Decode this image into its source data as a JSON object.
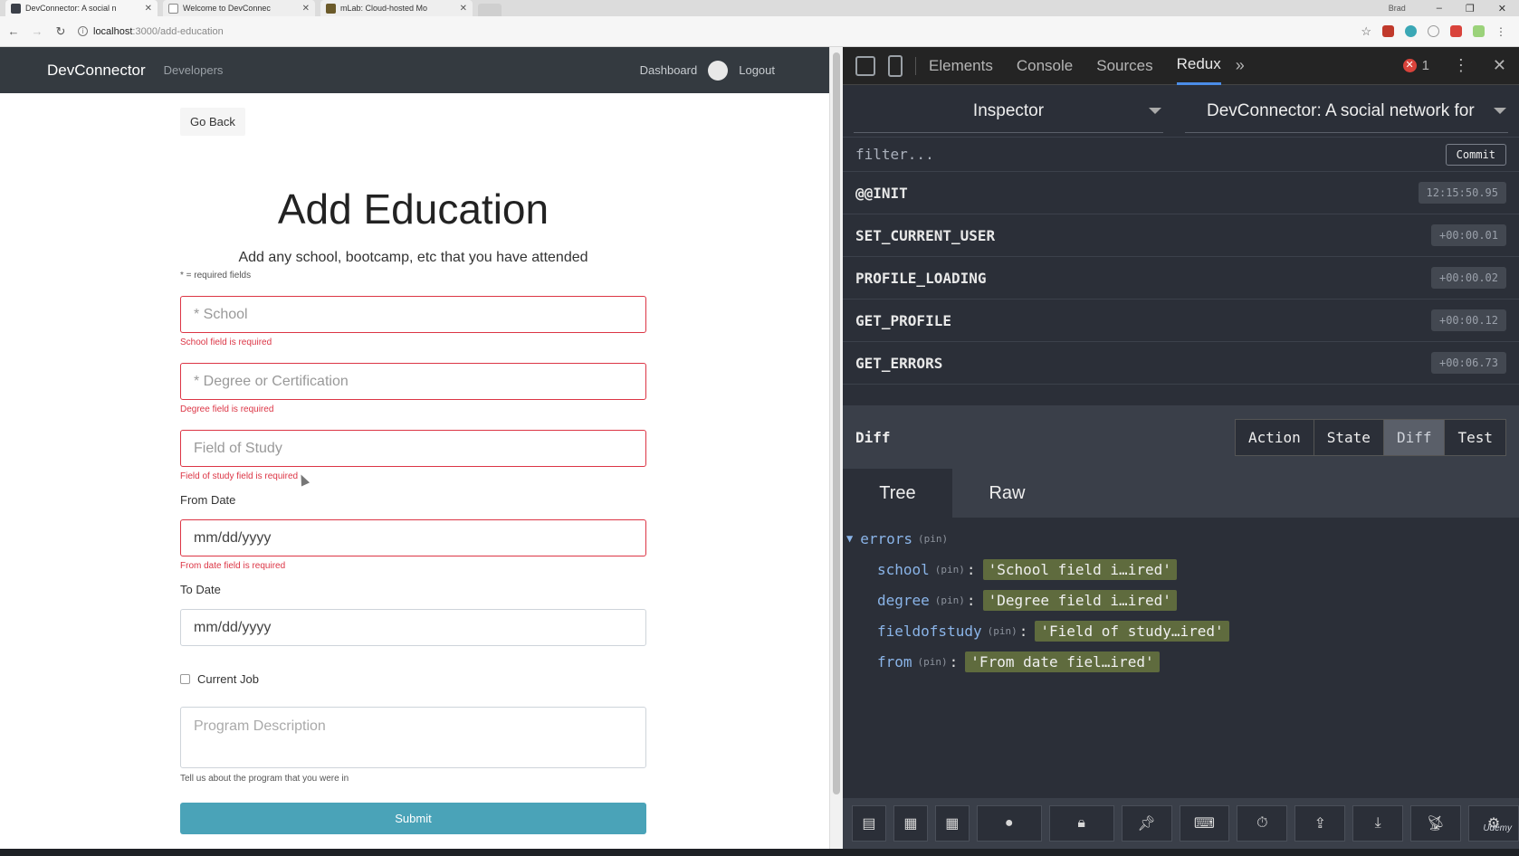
{
  "browser": {
    "tabs": [
      {
        "title": "DevConnector: A social n",
        "active": true
      },
      {
        "title": "Welcome to DevConnec",
        "active": false
      },
      {
        "title": "mLab: Cloud-hosted Mo",
        "active": false
      }
    ],
    "url_host": "localhost",
    "url_path": ":3000/add-education",
    "user": "Brad"
  },
  "app": {
    "brand": "DevConnector",
    "nav_developers": "Developers",
    "nav_dashboard": "Dashboard",
    "nav_logout": "Logout"
  },
  "form": {
    "go_back": "Go Back",
    "title": "Add Education",
    "lead": "Add any school, bootcamp, etc that you have attended",
    "required_note": "* = required fields",
    "school_placeholder": "* School",
    "school_error": "School field is required",
    "degree_placeholder": "* Degree or Certification",
    "degree_error": "Degree field is required",
    "field_placeholder": "Field of Study",
    "field_error": "Field of study field is required",
    "from_label": "From Date",
    "from_value": "mm/dd/yyyy",
    "from_error": "From date field is required",
    "to_label": "To Date",
    "to_value": "mm/dd/yyyy",
    "current_label": "Current Job",
    "desc_placeholder": "Program Description",
    "desc_help": "Tell us about the program that you were in",
    "submit": "Submit"
  },
  "devtools": {
    "tabs": [
      "Elements",
      "Console",
      "Sources",
      "Redux"
    ],
    "active_tab": "Redux",
    "more": "»",
    "error_count": "1",
    "redux": {
      "monitor": "Inspector",
      "instance": "DevConnector: A social network for",
      "filter_placeholder": "filter...",
      "commit": "Commit",
      "actions": [
        {
          "name": "@@INIT",
          "time": "12:15:50.95"
        },
        {
          "name": "SET_CURRENT_USER",
          "time": "+00:00.01"
        },
        {
          "name": "PROFILE_LOADING",
          "time": "+00:00.02"
        },
        {
          "name": "GET_PROFILE",
          "time": "+00:00.12"
        },
        {
          "name": "GET_ERRORS",
          "time": "+00:06.73"
        }
      ],
      "pane_label": "Diff",
      "pane_buttons": [
        "Action",
        "State",
        "Diff",
        "Test"
      ],
      "active_pane": "Diff",
      "view_tabs": [
        "Tree",
        "Raw"
      ],
      "active_view": "Tree",
      "tree": {
        "root": "errors",
        "pin": "(pin)",
        "entries": [
          {
            "key": "school",
            "value": "'School field i…ired'"
          },
          {
            "key": "degree",
            "value": "'Degree field i…ired'"
          },
          {
            "key": "fieldofstudy",
            "value": "'Field of study…ired'"
          },
          {
            "key": "from",
            "value": "'From date fiel…ired'"
          }
        ]
      }
    }
  },
  "watermark": "Udemy"
}
